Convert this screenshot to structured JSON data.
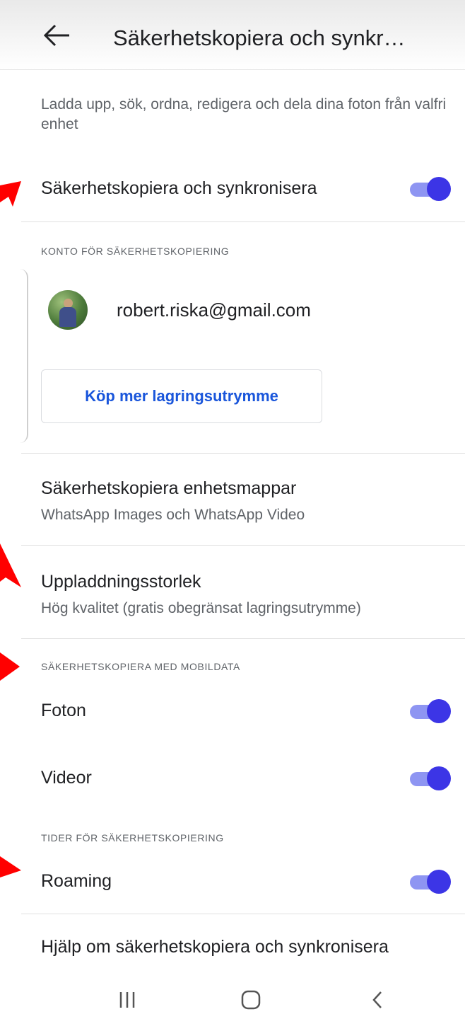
{
  "header": {
    "title": "Säkerhetskopiera och synkr…",
    "back_icon": "arrow-left-icon"
  },
  "description": "Ladda upp, sök, ordna, redigera och dela dina foton från valfri enhet",
  "backup_sync": {
    "label": "Säkerhetskopiera och synkronisera",
    "enabled": true
  },
  "account_section": {
    "header": "KONTO FÖR SÄKERHETSKOPIERING",
    "email": "robert.riska@gmail.com",
    "buy_storage_label": "Köp mer lagringsutrymme"
  },
  "device_folders": {
    "label": "Säkerhetskopiera enhetsmappar",
    "value": "WhatsApp Images och WhatsApp Video"
  },
  "upload_size": {
    "label": "Uppladdningsstorlek",
    "value": "Hög kvalitet (gratis obegränsat lagringsutrymme)"
  },
  "mobile_data_section": {
    "header": "SÄKERHETSKOPIERA MED MOBILDATA",
    "photos": {
      "label": "Foton",
      "enabled": true
    },
    "videos": {
      "label": "Videor",
      "enabled": true
    }
  },
  "backup_times_section": {
    "header": "TIDER FÖR SÄKERHETSKOPIERING",
    "roaming": {
      "label": "Roaming",
      "enabled": true
    }
  },
  "help_link": "Hjälp om säkerhetskopiera och synkronisera",
  "colors": {
    "accent": "#3c35e6",
    "accent_track": "#8e95f2",
    "link": "#1a56db",
    "annotation_arrow": "#ff0000"
  },
  "navbar": {
    "icons": [
      "recent-apps-icon",
      "home-icon",
      "back-icon"
    ]
  }
}
